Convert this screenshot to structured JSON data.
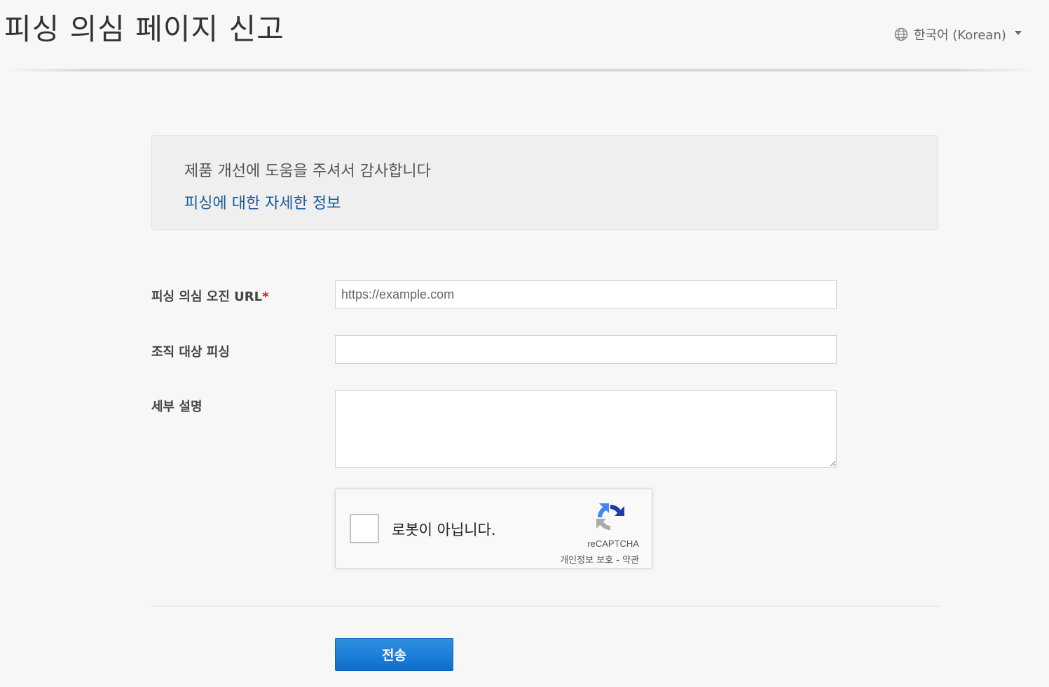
{
  "header": {
    "title": "피싱 의심 페이지 신고",
    "language": "한국어 (Korean)"
  },
  "info": {
    "thanks": "제품 개선에 도움을 주셔서 감사합니다",
    "link": "피싱에 대한 자세한 정보"
  },
  "form": {
    "url_label": "피싱 의심 오진 URL",
    "url_required_mark": "*",
    "url_placeholder": "https://example.com",
    "org_label": "조직 대상 피싱",
    "org_value": "",
    "detail_label": "세부 설명",
    "detail_value": ""
  },
  "recaptcha": {
    "label": "로봇이 아닙니다.",
    "brand": "reCAPTCHA",
    "privacy": "개인정보 보호",
    "separator": " - ",
    "terms": "약관"
  },
  "submit_label": "전송"
}
